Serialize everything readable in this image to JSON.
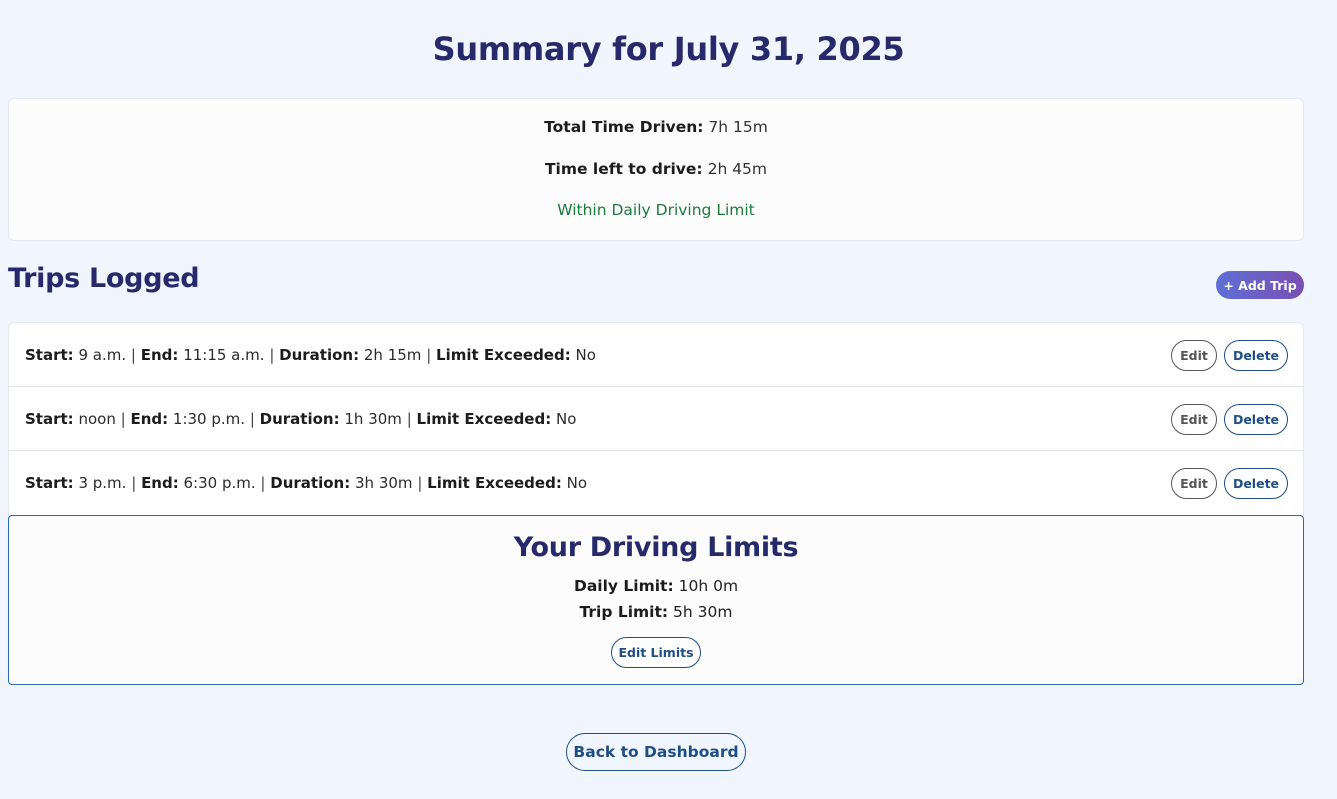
{
  "page": {
    "title": "Summary for July 31, 2025"
  },
  "summary": {
    "total_label": "Total Time Driven:",
    "total_value": "7h 15m",
    "left_label": "Time left to drive:",
    "left_value": "2h 45m",
    "status": "Within Daily Driving Limit",
    "status_color": "#1d7a3e"
  },
  "trips_section": {
    "title": "Trips Logged",
    "add_button": "+ Add Trip"
  },
  "labels": {
    "start": "Start:",
    "end": "End:",
    "duration": "Duration:",
    "limit_exceeded": "Limit Exceeded:",
    "separator": "|",
    "edit": "Edit",
    "delete": "Delete"
  },
  "trips": [
    {
      "start": "9 a.m.",
      "end": "11:15 a.m.",
      "duration": "2h 15m",
      "limit_exceeded": "No"
    },
    {
      "start": "noon",
      "end": "1:30 p.m.",
      "duration": "1h 30m",
      "limit_exceeded": "No"
    },
    {
      "start": "3 p.m.",
      "end": "6:30 p.m.",
      "duration": "3h 30m",
      "limit_exceeded": "No"
    }
  ],
  "limits": {
    "title": "Your Driving Limits",
    "daily_label": "Daily Limit:",
    "daily_value": "10h 0m",
    "trip_label": "Trip Limit:",
    "trip_value": "5h 30m",
    "edit_button": "Edit Limits"
  },
  "footer": {
    "back_button": "Back to Dashboard"
  },
  "colors": {
    "background": "#f0f5fe",
    "heading": "#262a6b",
    "accent": "#1f4e86",
    "add_gradient_start": "#5e6fd6",
    "add_gradient_end": "#7a4fb2"
  }
}
